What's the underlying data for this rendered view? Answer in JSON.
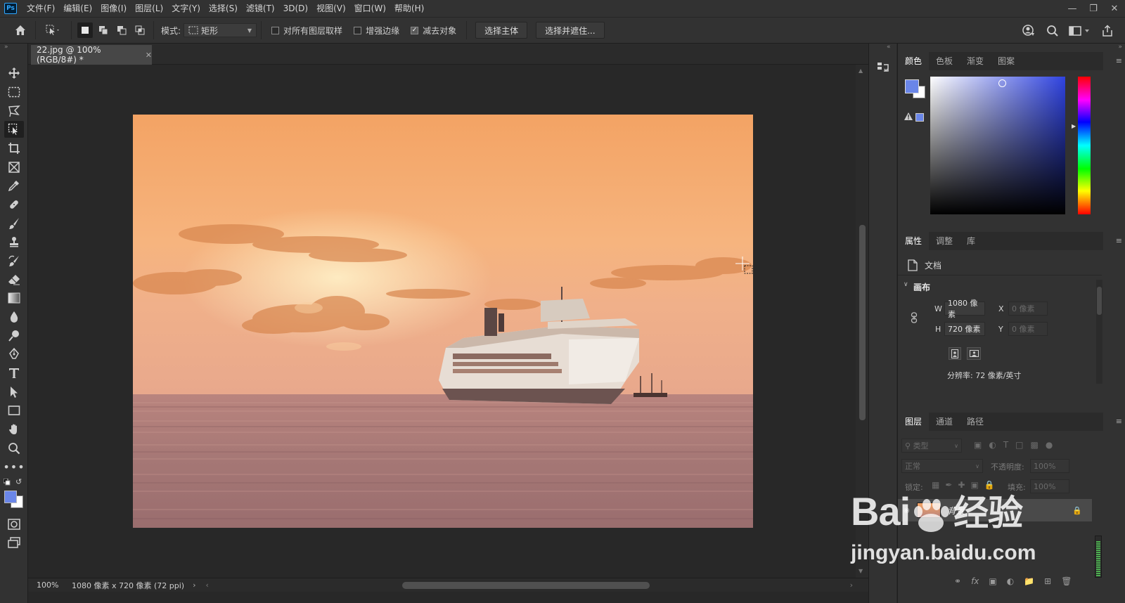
{
  "menubar": {
    "items": [
      "文件(F)",
      "编辑(E)",
      "图像(I)",
      "图层(L)",
      "文字(Y)",
      "选择(S)",
      "滤镜(T)",
      "3D(D)",
      "视图(V)",
      "窗口(W)",
      "帮助(H)"
    ]
  },
  "options": {
    "mode_label": "模式:",
    "mode_value": "矩形",
    "sample_all_label": "对所有图层取样",
    "sample_all_checked": false,
    "enhance_edge_label": "增强边缘",
    "enhance_edge_checked": false,
    "subtract_label": "减去对象",
    "subtract_checked": true,
    "select_subject_btn": "选择主体",
    "select_mask_btn": "选择并遮住..."
  },
  "document": {
    "tab_title": "22.jpg @ 100%(RGB/8#) *",
    "zoom": "100%",
    "info": "1080 像素 x 720 像素 (72 ppi)"
  },
  "color_panel": {
    "tabs": [
      "颜色",
      "色板",
      "渐变",
      "图案"
    ],
    "foreground": "#6a86e8",
    "background": "#ffffff",
    "hue": "#2f43e0"
  },
  "properties_panel": {
    "tabs": [
      "属性",
      "调整",
      "库"
    ],
    "doc_label": "文档",
    "canvas_label": "画布",
    "w_label": "W",
    "w_value": "1080 像素",
    "h_label": "H",
    "h_value": "720 像素",
    "x_label": "X",
    "x_value": "0 像素",
    "y_label": "Y",
    "y_value": "0 像素",
    "resolution": "分辨率: 72 像素/英寸"
  },
  "layers_panel": {
    "tabs": [
      "图层",
      "通道",
      "路径"
    ],
    "filter_placeholder": "类型",
    "blend_mode": "正常",
    "opacity_label": "不透明度:",
    "opacity_value": "100%",
    "lock_label": "锁定:",
    "fill_label": "填充:",
    "fill_value": "100%",
    "layer_name": "背景"
  },
  "watermark": {
    "text_main": "Bai",
    "text_cn": "经验",
    "url": "jingyan.baidu.com"
  }
}
